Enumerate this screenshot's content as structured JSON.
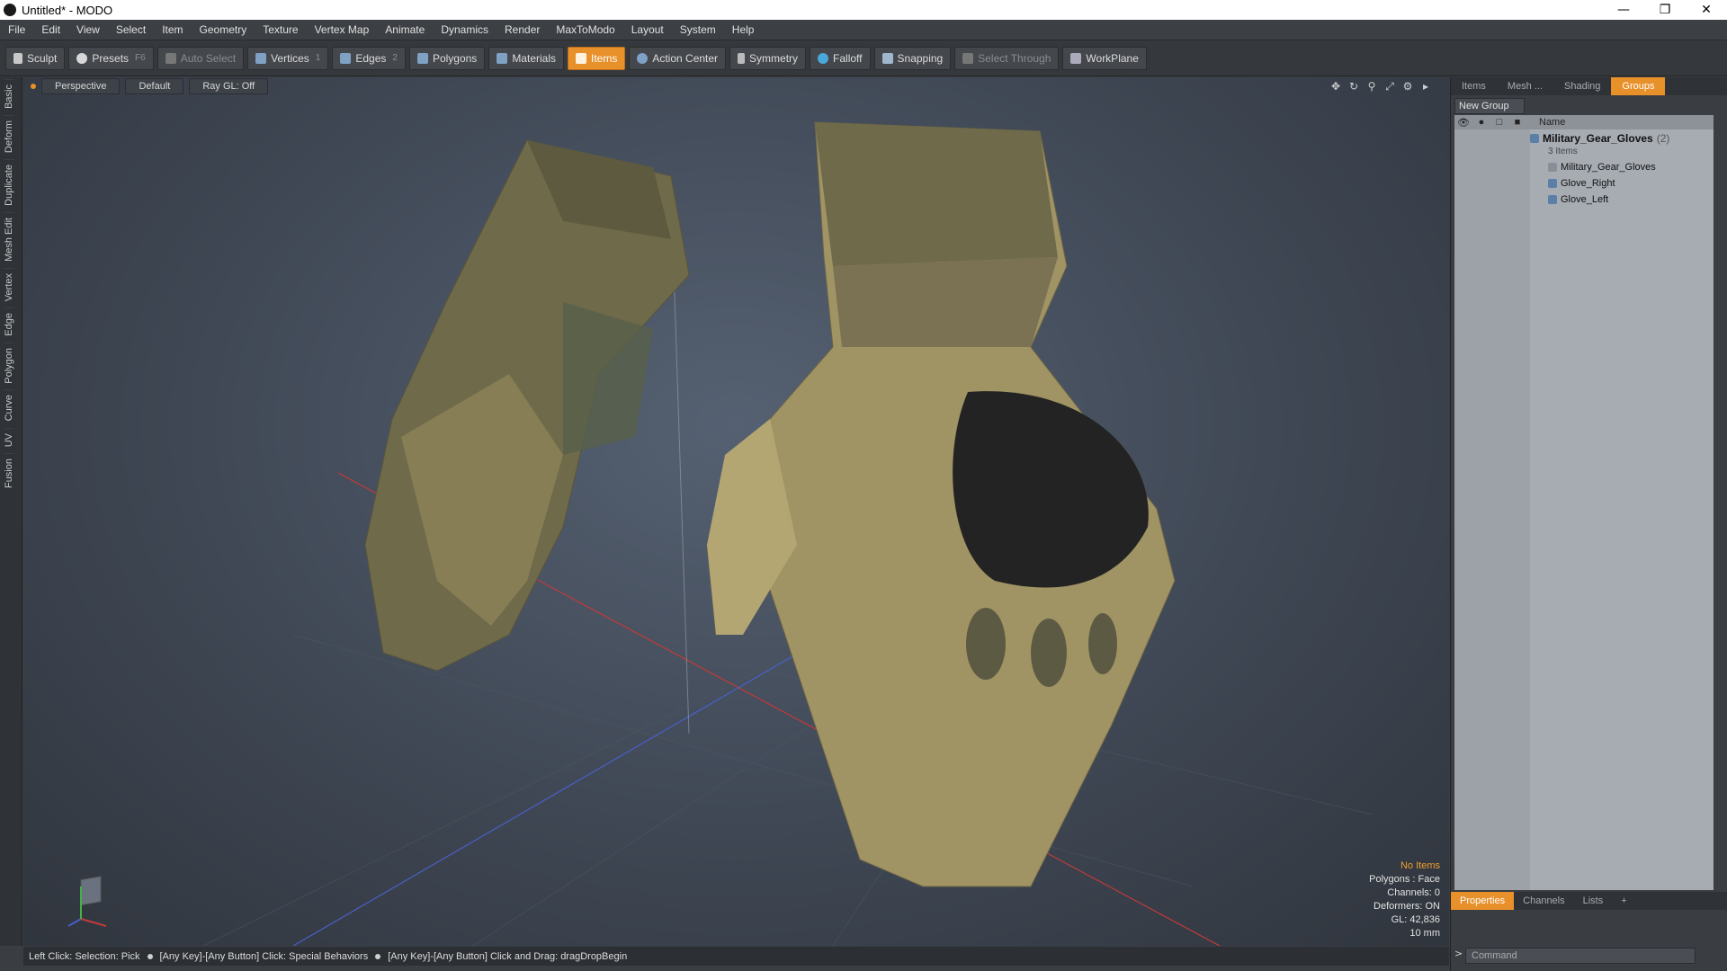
{
  "window": {
    "title": "Untitled* - MODO"
  },
  "menu": [
    "File",
    "Edit",
    "View",
    "Select",
    "Item",
    "Geometry",
    "Texture",
    "Vertex Map",
    "Animate",
    "Dynamics",
    "Render",
    "MaxToModo",
    "Layout",
    "System",
    "Help"
  ],
  "toolbar": {
    "sculpt": "Sculpt",
    "presets": "Presets",
    "presets_key": "F6",
    "auto_select": "Auto Select",
    "vertices": "Vertices",
    "vertices_key": "1",
    "edges": "Edges",
    "edges_key": "2",
    "polygons": "Polygons",
    "materials": "Materials",
    "items": "Items",
    "action_center": "Action Center",
    "symmetry": "Symmetry",
    "falloff": "Falloff",
    "snapping": "Snapping",
    "select_through": "Select Through",
    "workplane": "WorkPlane"
  },
  "left_tabs": [
    "Basic",
    "Deform",
    "Duplicate",
    "Mesh Edit",
    "Vertex",
    "Edge",
    "Polygon",
    "Curve",
    "UV",
    "Fusion"
  ],
  "viewport": {
    "view": "Perspective",
    "style": "Default",
    "raygl": "Ray GL: Off",
    "stats": {
      "items": "No Items",
      "polygons": "Polygons : Face",
      "channels": "Channels: 0",
      "deformers": "Deformers: ON",
      "gl": "GL: 42,836",
      "scale": "10 mm"
    }
  },
  "status_bar": {
    "part1": "Left Click: Selection: Pick",
    "part2": "[Any Key]-[Any Button] Click: Special Behaviors",
    "part3": "[Any Key]-[Any Button] Click and Drag: dragDropBegin"
  },
  "right_panel": {
    "tabs": [
      "Items",
      "Mesh ...",
      "Shading",
      "Groups"
    ],
    "new_group": "New Group",
    "name_col": "Name",
    "group_name": "Military_Gear_Gloves",
    "group_count": "(2)",
    "group_sub": "3 Items",
    "children": [
      "Military_Gear_Gloves",
      "Glove_Right",
      "Glove_Left"
    ],
    "bottom_tabs": [
      "Properties",
      "Channels",
      "Lists",
      "+"
    ],
    "command_placeholder": "Command"
  }
}
